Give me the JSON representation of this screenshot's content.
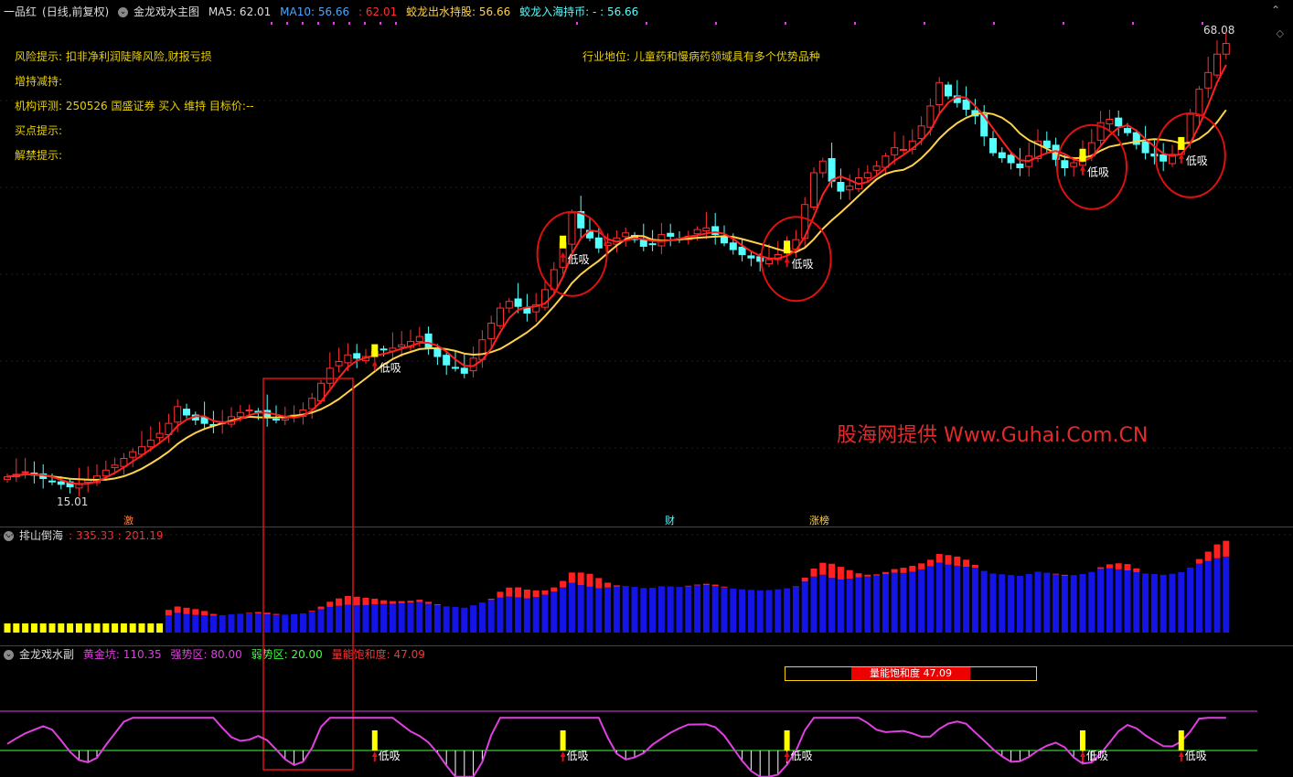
{
  "main_header": {
    "stock_name": "一品红",
    "period": "(日线,前复权)",
    "indicator_name": "金龙戏水主图",
    "ma5": "MA5: 62.01",
    "ma10": "MA10: 56.66",
    "val3": ": 62.01",
    "jiaolong_chushui": "蛟龙出水持股: 56.66",
    "jiaolong_ruhai": "蛟龙入海持币: - : 56.66"
  },
  "info_lines": {
    "risk": "风险提示: 扣非净利润陡降风险,财报亏损",
    "hold_change": "增持减持:",
    "rating": "机构评测: 250526 国盛证券 买入 维持 目标价:--",
    "buy_point": "买点提示:",
    "unlock": "解禁提示:",
    "industry": "行业地位: 儿童药和慢病药领域具有多个优势品种"
  },
  "price_labels": {
    "high": "68.08",
    "low": "15.01"
  },
  "buy_label": "低吸",
  "event_marks": [
    "激",
    "财",
    "涨榜"
  ],
  "watermark": "股海网提供 Www.Guhai.Com.CN",
  "sub1_header": {
    "name": "排山倒海",
    "values": ": 335.33 : 201.19"
  },
  "sub2_header": {
    "name": "金龙戏水副",
    "gold_pit": "黄金坑: 110.35",
    "strong_zone": "强势区: 80.00",
    "weak_zone": "弱势区: 20.00",
    "saturation": "量能饱和度: 47.09"
  },
  "saturation_box": {
    "label": "量能饱和度 47.09",
    "value": 47.09
  },
  "colors": {
    "up": "#ff3030",
    "down": "#54ffff",
    "ma5": "#ff2020",
    "ma10": "#ffd24a",
    "buy": "#ffff00",
    "circle": "#e01010",
    "blue_bar": "#1414e6",
    "purple": "#e040e0",
    "green": "#40ff40"
  },
  "chart_data": {
    "type": "candlestick",
    "price_range": [
      15.01,
      68.08
    ],
    "close": [
      16.2,
      16.5,
      16.8,
      16.4,
      16.0,
      15.6,
      15.3,
      15.01,
      15.4,
      15.8,
      16.3,
      17.0,
      17.6,
      18.4,
      19.2,
      19.8,
      20.6,
      21.4,
      22.6,
      24.6,
      23.6,
      23.0,
      22.6,
      22.4,
      22.8,
      23.4,
      23.9,
      24.2,
      24.0,
      23.4,
      23.0,
      23.2,
      23.6,
      24.2,
      25.6,
      27.4,
      29.2,
      30.0,
      30.8,
      30.4,
      30.6,
      31.2,
      31.4,
      31.6,
      32.0,
      32.4,
      33.0,
      31.6,
      30.6,
      29.6,
      29.2,
      28.6,
      30.4,
      32.6,
      34.6,
      36.4,
      37.2,
      36.6,
      35.8,
      36.8,
      38.6,
      41.0,
      44.2,
      47.8,
      46.0,
      44.8,
      43.6,
      44.2,
      44.8,
      45.4,
      44.6,
      43.8,
      44.0,
      45.2,
      45.0,
      44.6,
      45.0,
      45.8,
      46.0,
      45.2,
      44.2,
      43.4,
      42.8,
      42.4,
      42.0,
      42.2,
      42.8,
      43.6,
      44.6,
      48.8,
      52.6,
      54.0,
      51.6,
      50.4,
      51.0,
      52.0,
      52.6,
      53.4,
      54.6,
      55.6,
      55.4,
      56.4,
      58.2,
      60.6,
      63.4,
      61.8,
      61.0,
      60.2,
      59.4,
      57.0,
      55.0,
      54.4,
      53.8,
      53.2,
      54.6,
      56.4,
      55.6,
      54.2,
      53.2,
      53.8,
      54.6,
      56.2,
      58.6,
      59.0,
      58.2,
      57.4,
      56.0,
      55.0,
      54.6,
      54.0,
      54.8,
      56.0,
      59.6,
      62.6,
      64.6,
      66.8,
      68.08
    ],
    "series": [
      {
        "name": "MA5",
        "values": []
      },
      {
        "name": "MA10",
        "values": []
      }
    ],
    "buy_points_index": [
      41,
      62,
      87,
      120,
      131
    ],
    "sub1_values": [],
    "sub2_values": []
  }
}
